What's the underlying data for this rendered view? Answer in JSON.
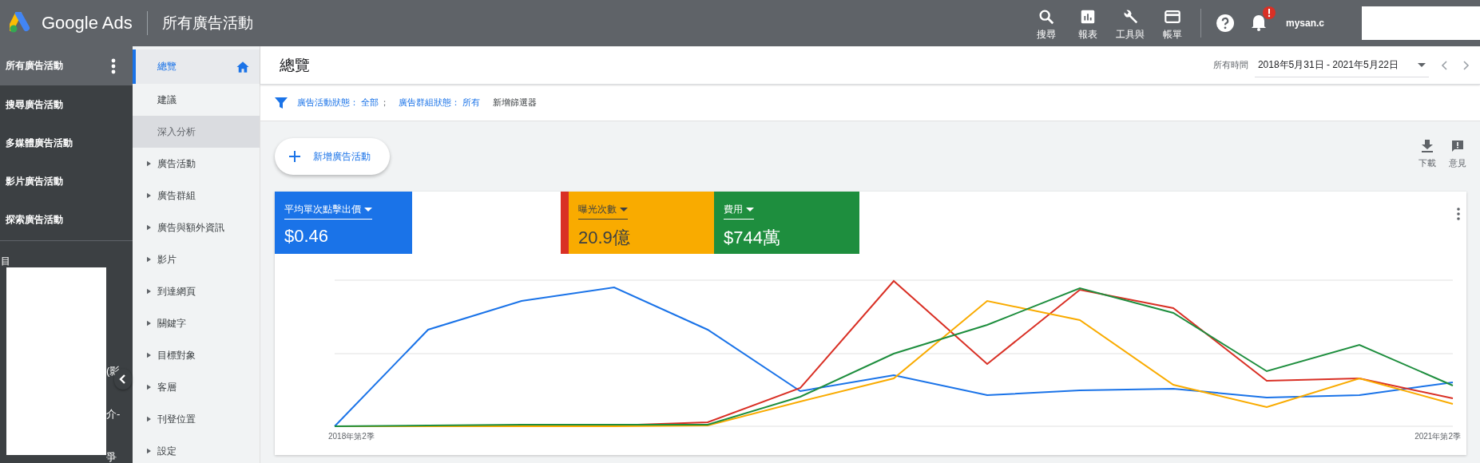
{
  "topbar": {
    "product": "Google Ads",
    "page_title": "所有廣告活動",
    "tools": [
      {
        "kind": "search",
        "label": "搜尋"
      },
      {
        "kind": "reports",
        "label": "報表"
      },
      {
        "kind": "tools",
        "label": "工具與"
      },
      {
        "kind": "billing",
        "label": "帳單"
      }
    ],
    "notification_alert": true,
    "account": "mysan.c"
  },
  "sidebar": {
    "items": [
      {
        "label": "所有廣告活動",
        "selected": true
      },
      {
        "label": "搜尋廣告活動",
        "selected": false
      },
      {
        "label": "多媒體廣告活動",
        "selected": false
      },
      {
        "label": "影片廣告活動",
        "selected": false
      },
      {
        "label": "探索廣告活動",
        "selected": false
      }
    ],
    "group_label": "目",
    "fragments": [
      "(影",
      "介-",
      "爭"
    ]
  },
  "nav": {
    "items": [
      {
        "label": "總覽",
        "selected": true,
        "expandable": false,
        "hovered": false
      },
      {
        "label": "建議",
        "selected": false,
        "expandable": false,
        "hovered": false
      },
      {
        "label": "深入分析",
        "selected": false,
        "expandable": false,
        "hovered": true
      },
      {
        "label": "廣告活動",
        "selected": false,
        "expandable": true,
        "hovered": false
      },
      {
        "label": "廣告群組",
        "selected": false,
        "expandable": true,
        "hovered": false
      },
      {
        "label": "廣告與額外資訊",
        "selected": false,
        "expandable": true,
        "hovered": false
      },
      {
        "label": "影片",
        "selected": false,
        "expandable": true,
        "hovered": false
      },
      {
        "label": "到達網頁",
        "selected": false,
        "expandable": true,
        "hovered": false
      },
      {
        "label": "關鍵字",
        "selected": false,
        "expandable": true,
        "hovered": false
      },
      {
        "label": "目標對象",
        "selected": false,
        "expandable": true,
        "hovered": false
      },
      {
        "label": "客層",
        "selected": false,
        "expandable": true,
        "hovered": false
      },
      {
        "label": "刊登位置",
        "selected": false,
        "expandable": true,
        "hovered": false
      },
      {
        "label": "設定",
        "selected": false,
        "expandable": true,
        "hovered": false
      }
    ]
  },
  "header": {
    "title": "總覽",
    "range_label": "所有時間",
    "date_range": "2018年5月31日 - 2021年5月22日"
  },
  "filters": {
    "items": [
      {
        "label": "廣告活動狀態：",
        "value": "全部"
      },
      {
        "label": "廣告群組狀態：",
        "value": "所有"
      }
    ],
    "separator": "；",
    "add_label": "新增篩選器"
  },
  "new_campaign_button": "新增廣告活動",
  "actions": [
    {
      "kind": "download",
      "label": "下載"
    },
    {
      "kind": "feedback",
      "label": "意見"
    }
  ],
  "metrics": [
    {
      "label": "平均單次點擊出價",
      "value": "$0.46",
      "color": "#1a73e8"
    },
    {
      "label": "曝光次數",
      "value": "20.9億",
      "color": "#f9ab00"
    },
    {
      "label": "費用",
      "value": "$744萬",
      "color": "#1e8e3e"
    }
  ],
  "chart": {
    "x_start": "2018年第2季",
    "x_end": "2021年第2季"
  }
}
